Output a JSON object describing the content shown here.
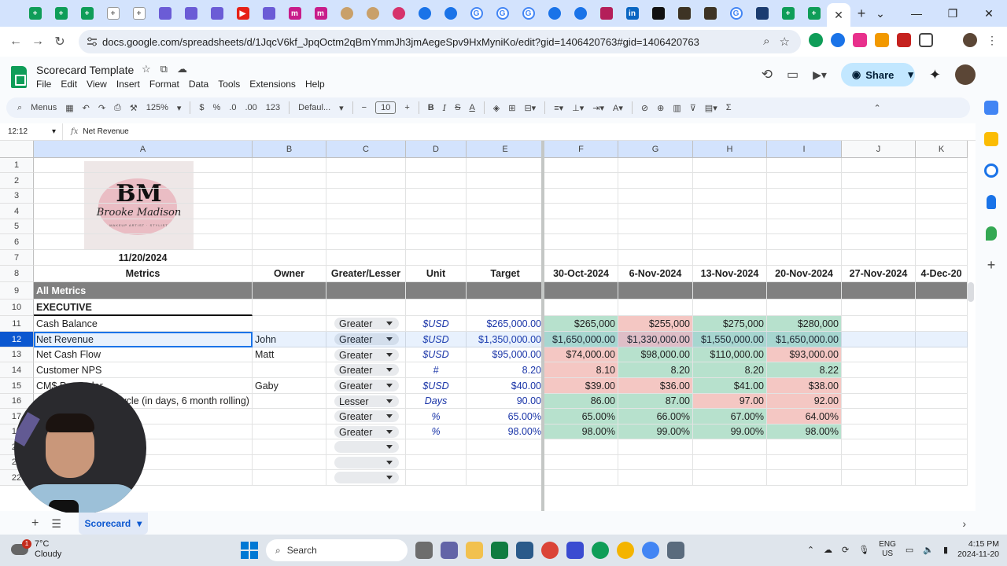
{
  "browser": {
    "url": "docs.google.com/spreadsheets/d/1JqcV6kf_JpqOctm2qBmYmmJh3jmAegeSpv9HxMyniKo/edit?gid=1406420763#gid=1406420763"
  },
  "app": {
    "title": "Scorecard Template",
    "menus": [
      "File",
      "Edit",
      "View",
      "Insert",
      "Format",
      "Data",
      "Tools",
      "Extensions",
      "Help"
    ],
    "share_label": "Share"
  },
  "toolbar": {
    "menus_label": "Menus",
    "zoom": "125%",
    "currency": "$",
    "percent": "%",
    "dec_less": ".0",
    "dec_more": ".00",
    "num_format": "123",
    "font": "Defaul...",
    "font_size": "10"
  },
  "formula_bar": {
    "cell_ref": "12:12",
    "fx": "fx",
    "value": "Net Revenue"
  },
  "columns": [
    "A",
    "B",
    "C",
    "D",
    "E",
    "F",
    "G",
    "H",
    "I",
    "J",
    "K"
  ],
  "rows": [
    "1",
    "2",
    "3",
    "4",
    "5",
    "6",
    "7",
    "8",
    "9",
    "10",
    "11",
    "12",
    "13",
    "14",
    "15",
    "16",
    "17",
    "18",
    "20",
    "21",
    "22"
  ],
  "logo": {
    "initials": "BM",
    "script": "Brooke Madison",
    "tagline": "MAKEUP ARTIST · STYLIST"
  },
  "sheet": {
    "date": "11/20/2024",
    "headers": [
      "Metrics",
      "Owner",
      "Greater/Lesser",
      "Unit",
      "Target"
    ],
    "week_headers": [
      "30-Oct-2024",
      "6-Nov-2024",
      "13-Nov-2024",
      "20-Nov-2024",
      "27-Nov-2024",
      "4-Dec-20"
    ],
    "all_metrics": "All Metrics",
    "executive": "EXECUTIVE",
    "metrics": [
      {
        "name": "Cash Balance",
        "owner": "",
        "dir": "Greater",
        "unit": "$USD",
        "target": "$265,000.00",
        "w": [
          "$265,000",
          "$255,000",
          "$275,000",
          "$280,000"
        ],
        "c": [
          "green",
          "red",
          "green",
          "green"
        ]
      },
      {
        "name": "Net Revenue",
        "owner": "John",
        "dir": "Greater",
        "unit": "$USD",
        "target": "$1,350,000.00",
        "w": [
          "$1,650,000.00",
          "$1,330,000.00",
          "$1,550,000.00",
          "$1,650,000.00"
        ],
        "c": [
          "green",
          "red",
          "green",
          "green"
        ]
      },
      {
        "name": "Net Cash Flow",
        "owner": "Matt",
        "dir": "Greater",
        "unit": "$USD",
        "target": "$95,000.00",
        "w": [
          "$74,000.00",
          "$98,000.00",
          "$110,000.00",
          "$93,000.00"
        ],
        "c": [
          "red",
          "green",
          "green",
          "red"
        ]
      },
      {
        "name": "Customer NPS",
        "owner": "",
        "dir": "Greater",
        "unit": "#",
        "target": "8.20",
        "w": [
          "8.10",
          "8.20",
          "8.20",
          "8.22"
        ],
        "c": [
          "red",
          "green",
          "green",
          "green"
        ]
      },
      {
        "name": "CM$ Per Order",
        "owner": "Gaby",
        "dir": "Greater",
        "unit": "$USD",
        "target": "$40.00",
        "w": [
          "$39.00",
          "$36.00",
          "$41.00",
          "$38.00"
        ],
        "c": [
          "red",
          "red",
          "green",
          "red"
        ]
      },
      {
        "name": "Cash Conversion Cycle (in days, 6 month rolling)",
        "owner": "",
        "dir": "Lesser",
        "unit": "Days",
        "target": "90.00",
        "w": [
          "86.00",
          "87.00",
          "97.00",
          "92.00"
        ],
        "c": [
          "green",
          "green",
          "red",
          "red"
        ]
      },
      {
        "name": "",
        "owner": "",
        "dir": "Greater",
        "unit": "%",
        "target": "65.00%",
        "w": [
          "65.00%",
          "66.00%",
          "67.00%",
          "64.00%"
        ],
        "c": [
          "green",
          "green",
          "green",
          "red"
        ]
      },
      {
        "name": "",
        "owner": "",
        "dir": "Greater",
        "unit": "%",
        "target": "98.00%",
        "w": [
          "98.00%",
          "99.00%",
          "99.00%",
          "98.00%"
        ],
        "c": [
          "green",
          "green",
          "green",
          "green"
        ]
      }
    ]
  },
  "sheet_tab": "Scorecard",
  "taskbar": {
    "temp": "7°C",
    "condition": "Cloudy",
    "badge": "1",
    "search": "Search",
    "lang1": "ENG",
    "lang2": "US",
    "time": "4:15 PM",
    "date": "2024-11-20"
  },
  "colors": {
    "green": "#b7e1cd",
    "red": "#f4c7c3",
    "accent": "#0b57d0"
  }
}
